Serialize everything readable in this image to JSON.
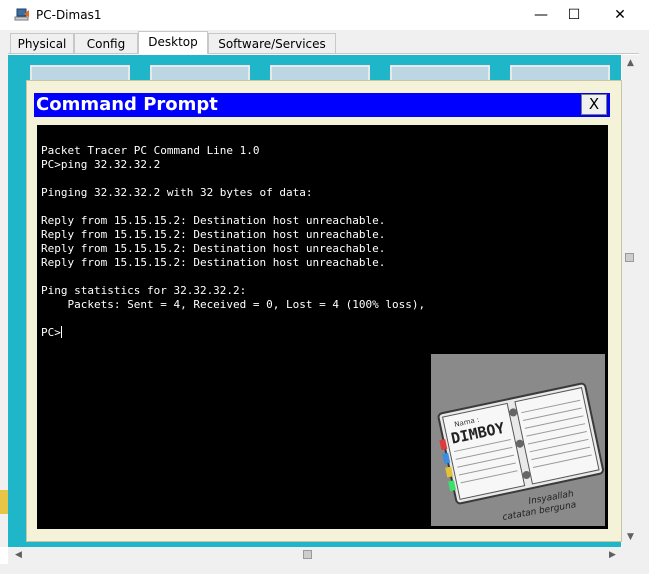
{
  "window": {
    "title": "PC-Dimas1",
    "icon": "packet-tracer-pc-icon",
    "controls": {
      "minimize": "—",
      "maximize": "☐",
      "close": "✕"
    }
  },
  "tabs": [
    {
      "label": "Physical",
      "active": false
    },
    {
      "label": "Config",
      "active": false
    },
    {
      "label": "Desktop",
      "active": true
    },
    {
      "label": "Software/Services",
      "active": false
    }
  ],
  "desktop": {
    "background_color": "#1fb6c9",
    "icons": [
      "desktop-app-icon-1",
      "desktop-app-icon-2",
      "desktop-app-icon-3",
      "desktop-app-icon-4",
      "desktop-app-icon-5"
    ]
  },
  "command_prompt": {
    "title": "Command Prompt",
    "close_label": "X",
    "header_color": "#0000ff",
    "lines": [
      "Packet Tracer PC Command Line 1.0",
      "PC>ping 32.32.32.2",
      "",
      "Pinging 32.32.32.2 with 32 bytes of data:",
      "",
      "Reply from 15.15.15.2: Destination host unreachable.",
      "Reply from 15.15.15.2: Destination host unreachable.",
      "Reply from 15.15.15.2: Destination host unreachable.",
      "Reply from 15.15.15.2: Destination host unreachable.",
      "",
      "Ping statistics for 32.32.32.2:",
      "    Packets: Sent = 4, Received = 0, Lost = 4 (100% loss),",
      ""
    ],
    "prompt": "PC>"
  },
  "watermark": {
    "name_label": "Nama :",
    "name": "DIMBOY",
    "caption_line1": "Insyaallah",
    "caption_line2": "catatan berguna"
  },
  "scrollbars": {
    "up_arrow": "▲",
    "down_arrow": "▼",
    "left_arrow": "◀",
    "right_arrow": "▶"
  }
}
